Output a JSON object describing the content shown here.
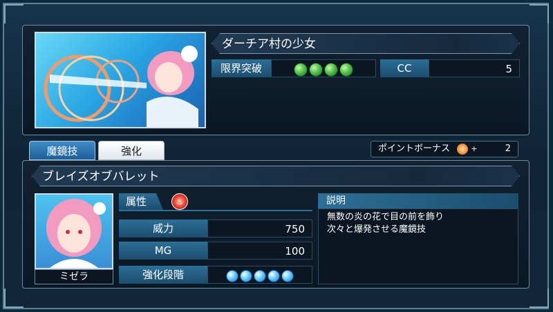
{
  "card": {
    "title": "ダーチア村の少女",
    "limit_break_label": "限界突破",
    "limit_break_gems": 4,
    "cc_label": "CC",
    "cc_value": "5"
  },
  "tabs": [
    {
      "label": "魔鏡技",
      "active": true
    },
    {
      "label": "強化",
      "active": false
    }
  ],
  "point_bonus": {
    "label": "ポイントボーナス",
    "plus": "+",
    "value": "2"
  },
  "skill": {
    "name": "ブレイズオブバレット",
    "attribute_label": "属性",
    "attribute_icon": "fire-icon",
    "power_label": "威力",
    "power_value": "750",
    "mg_label": "MG",
    "mg_value": "100",
    "enhance_label": "強化段階",
    "enhance_level": 5,
    "description_header": "説明",
    "description_line1": "無数の炎の花で目の前を飾り",
    "description_line2": "次々と爆発させる魔鏡技"
  },
  "character": {
    "name": "ミゼラ"
  },
  "colors": {
    "accent": "#2d6f96",
    "gem": "#52c24a",
    "orb": "#6fd0ff",
    "fire": "#e83a2a"
  }
}
